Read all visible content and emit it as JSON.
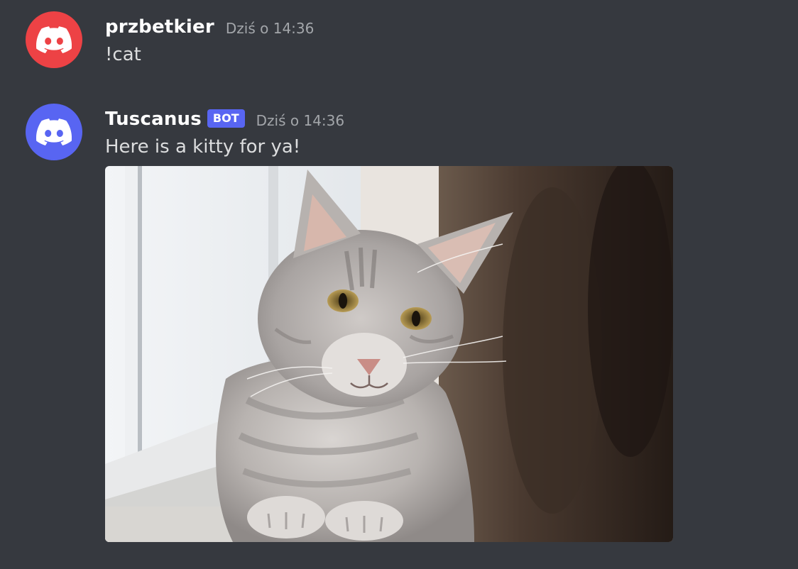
{
  "messages": [
    {
      "author": "przbetkier",
      "timestamp": "Dziś o 14:36",
      "content": "!cat",
      "avatar": {
        "icon": "discord-logo-icon",
        "color": "#ed4245"
      },
      "is_bot": false
    },
    {
      "author": "Tuscanus",
      "bot_tag": "BOT",
      "timestamp": "Dziś o 14:36",
      "content": "Here is a kitty for ya!",
      "avatar": {
        "icon": "discord-logo-icon",
        "color": "#5865f2"
      },
      "is_bot": true,
      "attachment": {
        "type": "image",
        "subject": "cat-photo"
      }
    }
  ],
  "colors": {
    "background": "#36393f",
    "bot_tag": "#5865f2",
    "username": "#ffffff",
    "timestamp": "#a3a6aa",
    "message_text": "#dcddde"
  }
}
